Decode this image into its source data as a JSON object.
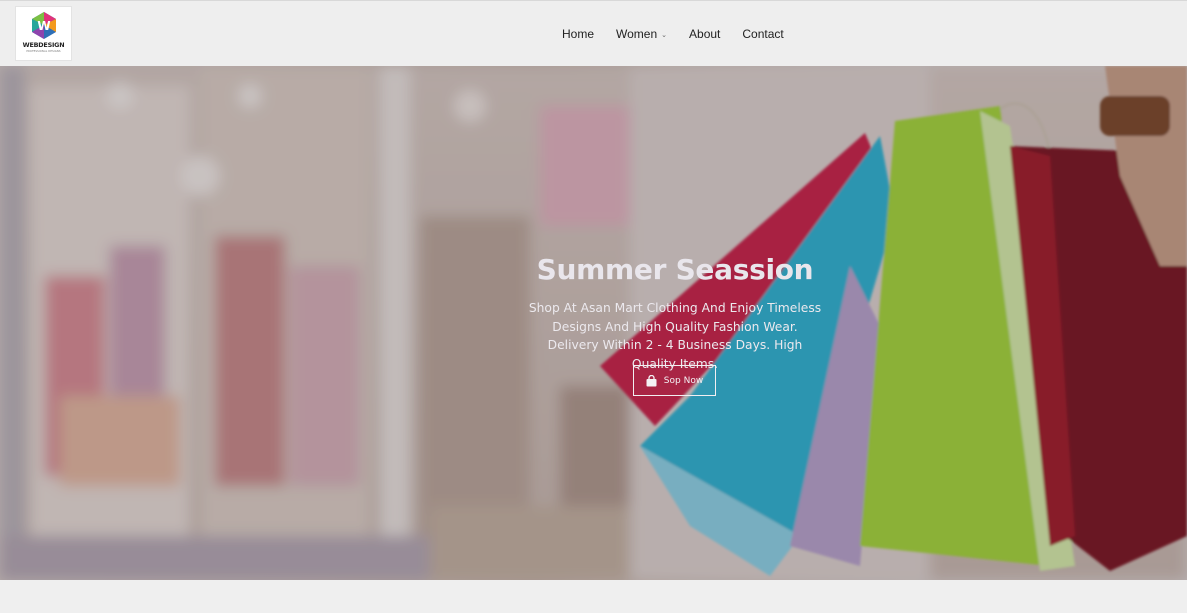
{
  "header": {
    "logo_text": "WEBDESIGN",
    "logo_sub": "PROFESSIONAL DESIGNS"
  },
  "nav": {
    "items": [
      {
        "label": "Home"
      },
      {
        "label": "Women",
        "dropdown": true
      },
      {
        "label": "About"
      },
      {
        "label": "Contact"
      }
    ]
  },
  "hero": {
    "title": "Summer Seassion",
    "text": "Shop At Asan Mart Clothing And Enjoy Timeless Designs And High Quality Fashion Wear. Delivery Within 2 - 4 Business Days. High Quality Items.",
    "button_label": "Sop Now",
    "button_icon": "shopping-bag-icon"
  },
  "colors": {
    "header_bg": "#eeeeee",
    "page_bg": "#efefef",
    "bag_red": "#c8234a",
    "bag_blue": "#2fb3d2",
    "bag_green": "#a4d63a",
    "bag_maroon": "#7a1420"
  }
}
